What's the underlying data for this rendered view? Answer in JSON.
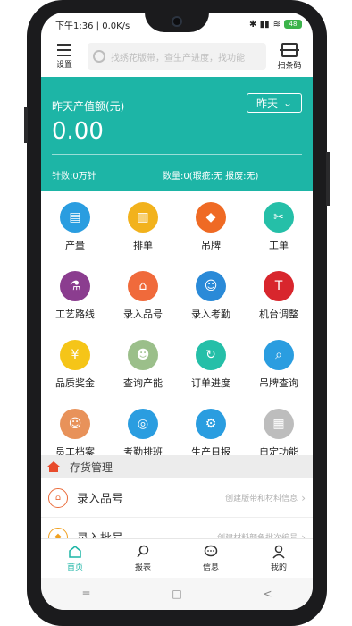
{
  "status": {
    "time": "下午1:36",
    "speed": "0.0K/s",
    "battery": "48"
  },
  "top_bar": {
    "menu_label": "设置",
    "search_placeholder": "找绣花版带，查生产进度，找功能",
    "scan_label": "扫条码"
  },
  "banner": {
    "title": "昨天产值额(元)",
    "period": "昨天",
    "amount": "0.00",
    "stitch": "针数:0万针",
    "quantity": "数量:0(瑕疵:无 报废:无)"
  },
  "grid": [
    {
      "label": "产量",
      "icon": "production-icon",
      "color": "#2a9de0"
    },
    {
      "label": "排单",
      "icon": "schedule-chart-icon",
      "color": "#f2b21c"
    },
    {
      "label": "吊牌",
      "icon": "tag-icon",
      "color": "#ef6a24"
    },
    {
      "label": "工单",
      "icon": "sewing-machine-icon",
      "color": "#25bfa8"
    },
    {
      "label": "工艺路线",
      "icon": "flask-icon",
      "color": "#8b3d8f"
    },
    {
      "label": "录入品号",
      "icon": "house-icon",
      "color": "#f06a3b"
    },
    {
      "label": "录入考勤",
      "icon": "person-icon",
      "color": "#2a8ad8"
    },
    {
      "label": "机台调整",
      "icon": "tajima-logo-icon",
      "color": "#d8262d"
    },
    {
      "label": "品质奖金",
      "icon": "bonus-icon",
      "color": "#f5c518"
    },
    {
      "label": "查询产能",
      "icon": "worker-icon",
      "color": "#9bbf8a"
    },
    {
      "label": "订单进度",
      "icon": "order-progress-icon",
      "color": "#25bfa8"
    },
    {
      "label": "吊牌查询",
      "icon": "tag-search-icon",
      "color": "#2a9de0"
    },
    {
      "label": "员工档案",
      "icon": "employee-avatar-icon",
      "color": "#e8925a"
    },
    {
      "label": "考勤排班",
      "icon": "fingerprint-icon",
      "color": "#2a9de0"
    },
    {
      "label": "生产日报",
      "icon": "robot-arm-icon",
      "color": "#2a9de0"
    },
    {
      "label": "自定功能",
      "icon": "grid-icon",
      "color": "#bdbdbd"
    }
  ],
  "section": {
    "title": "存货管理"
  },
  "list": [
    {
      "title": "录入品号",
      "subtitle": "创建版带和材料信息"
    },
    {
      "title": "录入批号",
      "subtitle": "创建材料颜色批次编号"
    }
  ],
  "tabs": [
    {
      "label": "首页"
    },
    {
      "label": "报表"
    },
    {
      "label": "信息"
    },
    {
      "label": "我的"
    }
  ],
  "nav": {
    "menu": "≡",
    "home": "□",
    "back": "<"
  }
}
